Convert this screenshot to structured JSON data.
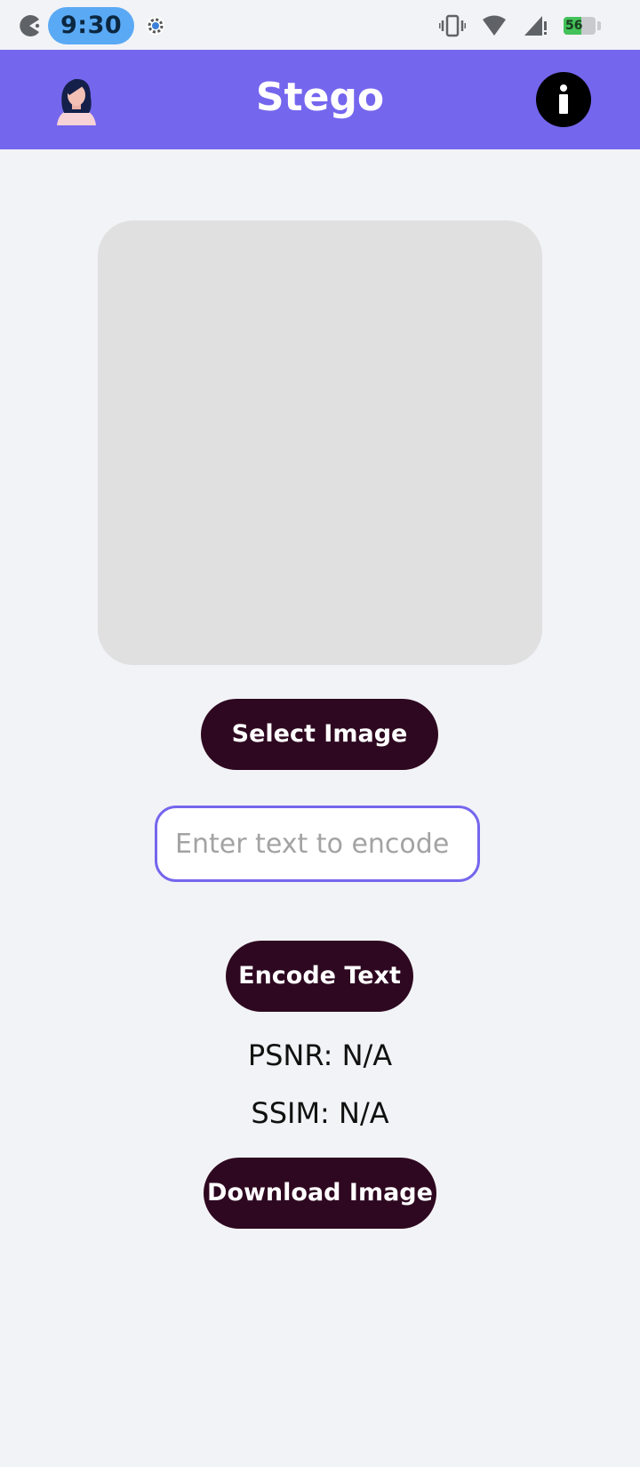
{
  "status_bar": {
    "time": "9:30",
    "battery_level": "56",
    "icons": [
      "pacman-icon",
      "settings-gear-icon",
      "vibrate-icon",
      "wifi-icon",
      "signal-icon",
      "battery-charging-icon"
    ]
  },
  "app_bar": {
    "title": "Stego",
    "avatar_icon": "woman-avatar-icon",
    "info_icon": "info-icon",
    "background_color": "#7566ee"
  },
  "main": {
    "image_placeholder_color": "#e0e0e0",
    "select_image_label": "Select Image",
    "text_input": {
      "value": "",
      "placeholder": "Enter text to encode"
    },
    "encode_label": "Encode Text",
    "psnr_text": "PSNR: N/A",
    "ssim_text": "SSIM: N/A",
    "download_label": "Download Image",
    "button_color": "#2e0820"
  }
}
